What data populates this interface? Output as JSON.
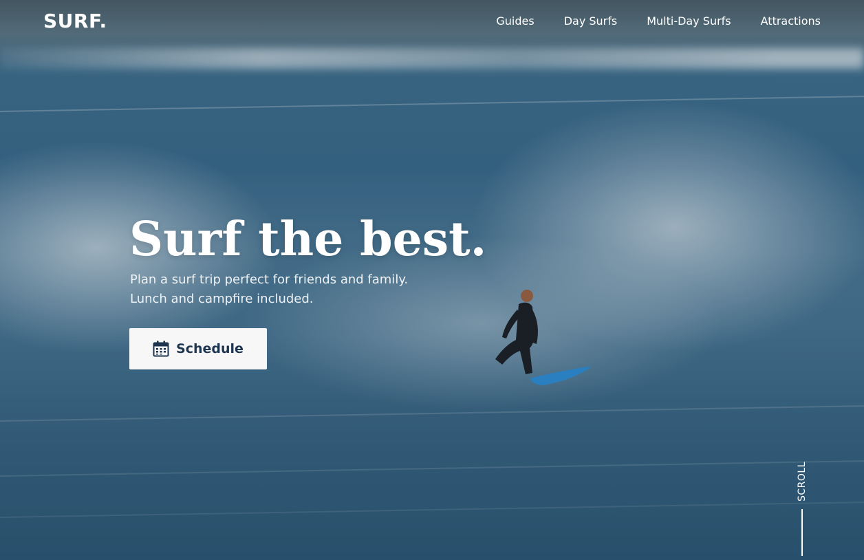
{
  "header": {
    "brand": "SURF.",
    "nav": [
      {
        "label": "Guides"
      },
      {
        "label": "Day Surfs"
      },
      {
        "label": "Multi-Day Surfs"
      },
      {
        "label": "Attractions"
      }
    ]
  },
  "hero": {
    "title": "Surf the best.",
    "subtitle_line1": "Plan a surf trip perfect for friends and family.",
    "subtitle_line2": "Lunch and campfire included.",
    "cta_label": "Schedule",
    "cta_icon": "calendar-icon",
    "background": "ocean-wave-surfer-photo"
  },
  "scroll_indicator": {
    "label": "SCROLL"
  },
  "colors": {
    "cta_background": "#f7f7f7",
    "cta_text": "#1e3550",
    "text": "#ffffff"
  }
}
